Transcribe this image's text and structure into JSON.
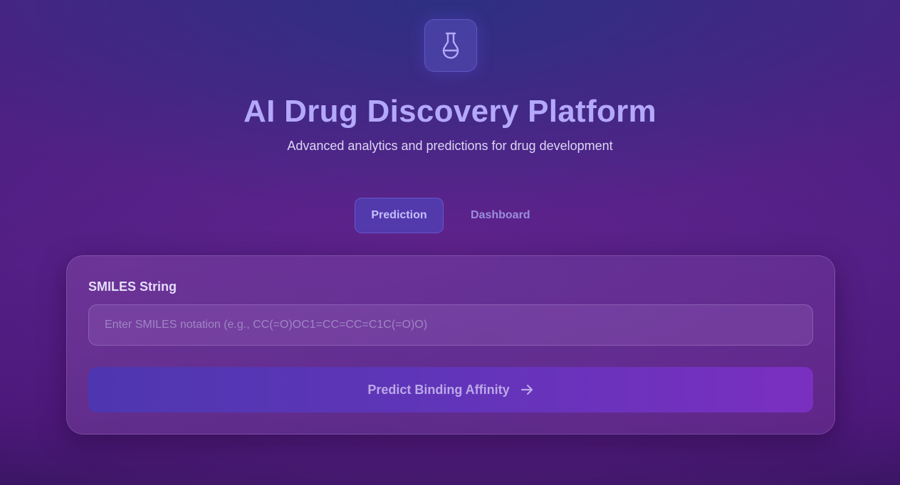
{
  "header": {
    "logo_icon": "flask-icon",
    "title": "AI Drug Discovery Platform",
    "subtitle": "Advanced analytics and predictions for drug development"
  },
  "tabs": [
    {
      "label": "Prediction",
      "active": true
    },
    {
      "label": "Dashboard",
      "active": false
    }
  ],
  "form": {
    "smiles_label": "SMILES String",
    "smiles_value": "",
    "smiles_placeholder": "Enter SMILES notation (e.g., CC(=O)OC1=CC=CC=C1C(=O)O)",
    "submit_label": "Predict Binding Affinity",
    "submit_icon": "arrow-right-icon"
  },
  "colors": {
    "accent": "#b4a8fb",
    "button_start": "#4e36b0",
    "button_end": "#7a2fc0"
  }
}
